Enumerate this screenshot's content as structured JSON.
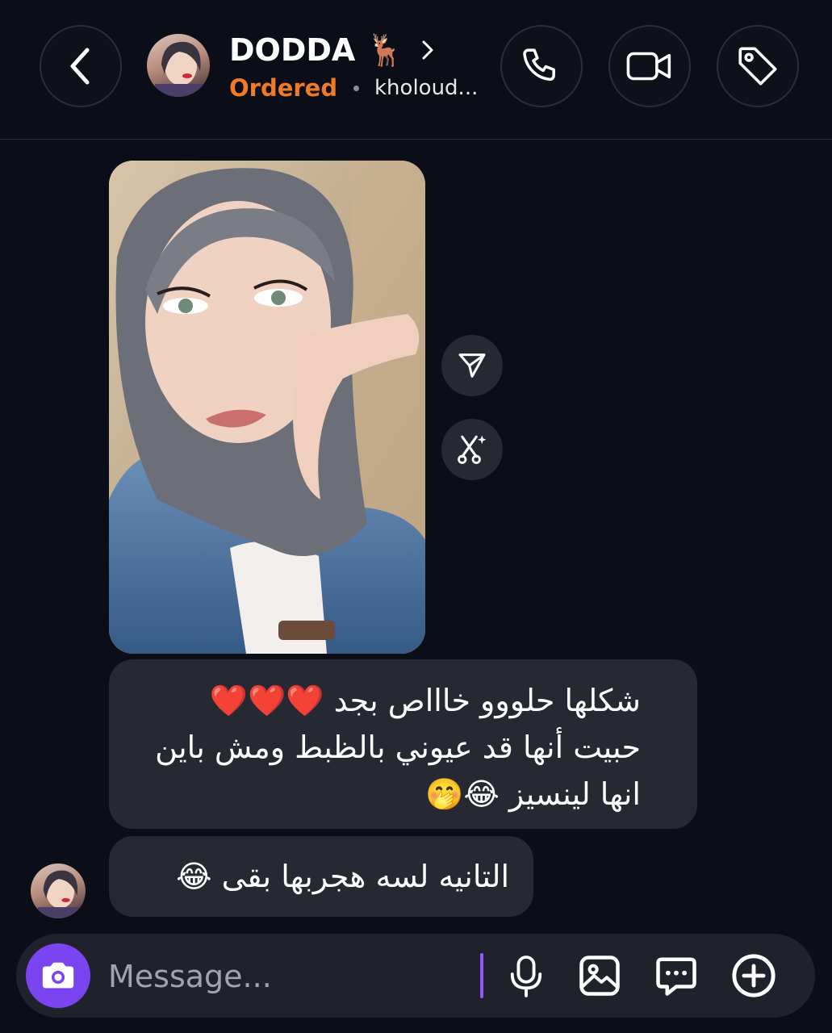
{
  "header": {
    "contact_name": "DODDA 🦌",
    "status_label": "Ordered",
    "handle": "kholoud...",
    "status_color": "#f07a26",
    "icons": [
      "back-chevron-icon",
      "chevron-right-icon",
      "phone-icon",
      "video-camera-icon",
      "tag-icon"
    ]
  },
  "messages": [
    {
      "type": "image",
      "description_icon": "photo"
    },
    {
      "type": "text",
      "lines": [
        "شكلها حلووو خاااص بجد ❤️❤️❤️",
        "حبيت أنها قد عيوني بالظبط ومش باين",
        "انها لينسيز 😂🤭"
      ]
    },
    {
      "type": "text",
      "lines": [
        "التانيه لسه هجربها بقى 😂"
      ]
    }
  ],
  "image_actions": [
    "share-icon",
    "ai-remix-icon"
  ],
  "composer": {
    "placeholder": "Message...",
    "accent_color": "#7a45f0",
    "icons": [
      "camera-icon",
      "microphone-icon",
      "gallery-icon",
      "sticker-chat-icon",
      "plus-icon"
    ]
  }
}
